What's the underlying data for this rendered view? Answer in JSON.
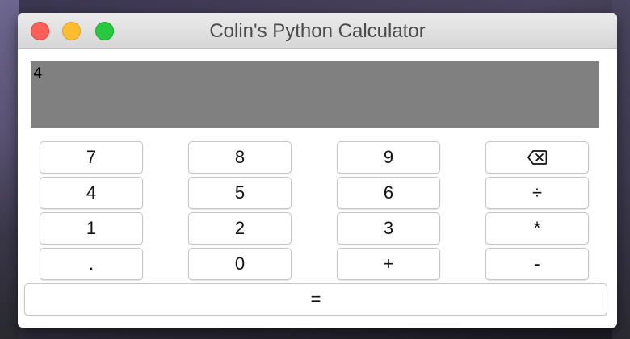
{
  "window": {
    "title": "Colin's Python Calculator"
  },
  "display": {
    "value": "4"
  },
  "keys": {
    "k7": "7",
    "k8": "8",
    "k9": "9",
    "k4": "4",
    "k5": "5",
    "k6": "6",
    "divide": "÷",
    "k1": "1",
    "k2": "2",
    "k3": "3",
    "multiply": "*",
    "dot": ".",
    "k0": "0",
    "plus": "+",
    "minus": "-",
    "equals": "="
  },
  "icons": {
    "backspace": "backspace-icon"
  }
}
